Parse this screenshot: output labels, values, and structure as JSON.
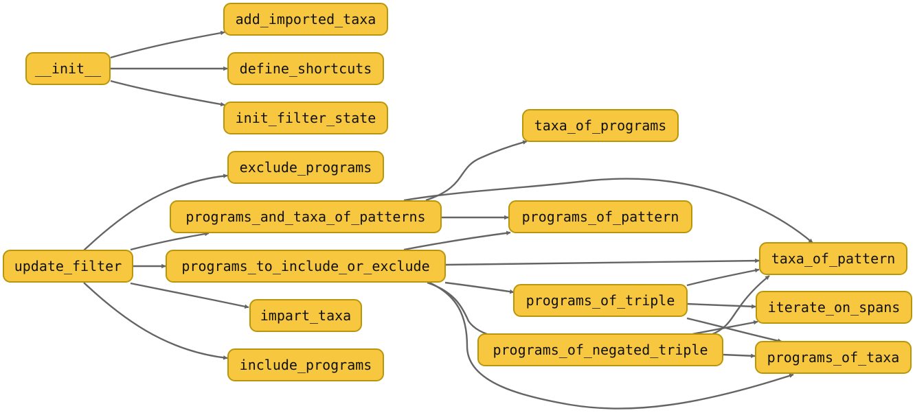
{
  "nodes": {
    "init": "__init__",
    "add_imported_taxa": "add_imported_taxa",
    "define_shortcuts": "define_shortcuts",
    "init_filter_state": "init_filter_state",
    "taxa_of_programs": "taxa_of_programs",
    "exclude_programs": "exclude_programs",
    "programs_and_taxa_of_patterns": "programs_and_taxa_of_patterns",
    "programs_of_pattern": "programs_of_pattern",
    "update_filter": "update_filter",
    "programs_to_include_or_exclude": "programs_to_include_or_exclude",
    "taxa_of_pattern": "taxa_of_pattern",
    "programs_of_triple": "programs_of_triple",
    "iterate_on_spans": "iterate_on_spans",
    "impart_taxa": "impart_taxa",
    "programs_of_negated_triple": "programs_of_negated_triple",
    "programs_of_taxa": "programs_of_taxa",
    "include_programs": "include_programs"
  },
  "colors": {
    "node_fill": "#f6c73f",
    "node_border": "#b8960c",
    "edge": "#646464",
    "text": "#111111"
  }
}
